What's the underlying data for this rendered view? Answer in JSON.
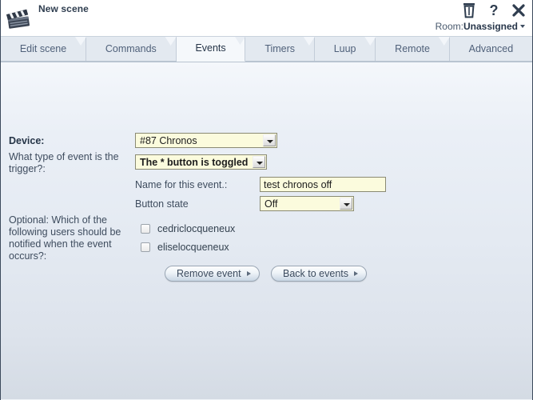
{
  "header": {
    "scene_title": "New scene",
    "icons": [
      {
        "name": "trash-icon",
        "glyph": "trash"
      },
      {
        "name": "help-icon",
        "glyph": "question"
      },
      {
        "name": "close-icon",
        "glyph": "cross"
      }
    ],
    "room_label": "Room:",
    "room_value": "Unassigned"
  },
  "tabs": [
    {
      "label": "Edit scene",
      "active": false
    },
    {
      "label": "Commands",
      "active": false
    },
    {
      "label": "Events",
      "active": true
    },
    {
      "label": "Timers",
      "active": false
    },
    {
      "label": "Luup",
      "active": false
    },
    {
      "label": "Remote",
      "active": false
    },
    {
      "label": "Advanced",
      "active": false
    }
  ],
  "form": {
    "device_label": "Device:",
    "device_value": "#87 Chronos",
    "trigger_label": "What type of event is the trigger?:",
    "trigger_value": "The * button is toggled",
    "event_name_label": "Name for this event.:",
    "event_name_value": "test chronos off",
    "event_name_placeholder": "",
    "button_state_label": "Button state",
    "button_state_value": "Off",
    "notify_label": "Optional: Which of the following users should be notified when the event occurs?:",
    "users": [
      {
        "name": "cedriclocqueneux",
        "checked": false
      },
      {
        "name": "eliselocqueneux",
        "checked": false
      }
    ],
    "remove_button": "Remove event",
    "back_button": "Back to events"
  },
  "colors": {
    "field_background": "#fbfbdd",
    "content_top": "#f4f7fb",
    "content_bottom": "#d4dbe4",
    "text": "#3e4c5e",
    "border": "#3c4a5c"
  }
}
